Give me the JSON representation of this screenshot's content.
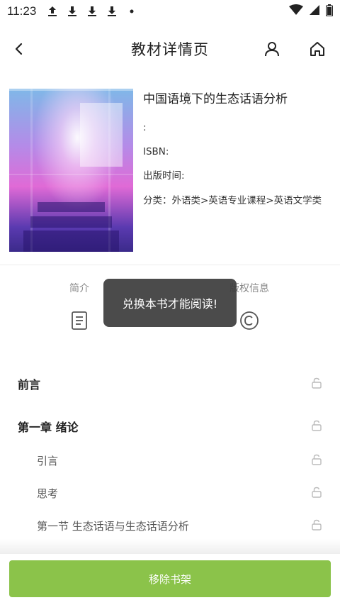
{
  "status_bar": {
    "time": "11:23",
    "icons": [
      "upload-icon",
      "download-icon",
      "download-icon",
      "download-icon",
      "dot-icon"
    ],
    "right_icons": [
      "wifi-icon",
      "signal-icon",
      "battery-icon"
    ]
  },
  "header": {
    "title": "教材详情页",
    "back_icon": "back-arrow-icon",
    "user_icon": "user-icon",
    "home_icon": "home-icon"
  },
  "book": {
    "title": "中国语境下的生态话语分析",
    "author_line": ":",
    "isbn_label": "ISBN:",
    "publish_label": "出版时间:",
    "category_label": "分类：外语类>英语专业课程>英语文学类"
  },
  "tabs": [
    {
      "label": "简介",
      "icon": "document-icon"
    },
    {
      "label": "版权信息",
      "icon": "copyright-icon"
    }
  ],
  "toast": {
    "text": "兑换本书才能阅读!"
  },
  "chapters": [
    {
      "label": "前言",
      "level": "top"
    },
    {
      "label": "第一章 绪论",
      "level": "top"
    },
    {
      "label": "引言",
      "level": "sub"
    },
    {
      "label": "思考",
      "level": "sub"
    },
    {
      "label": "第一节 生态话语与生态话语分析",
      "level": "sub"
    }
  ],
  "bottom": {
    "remove_label": "移除书架"
  },
  "colors": {
    "accent": "#8bc34a",
    "toast_bg": "#3c3c3c"
  }
}
